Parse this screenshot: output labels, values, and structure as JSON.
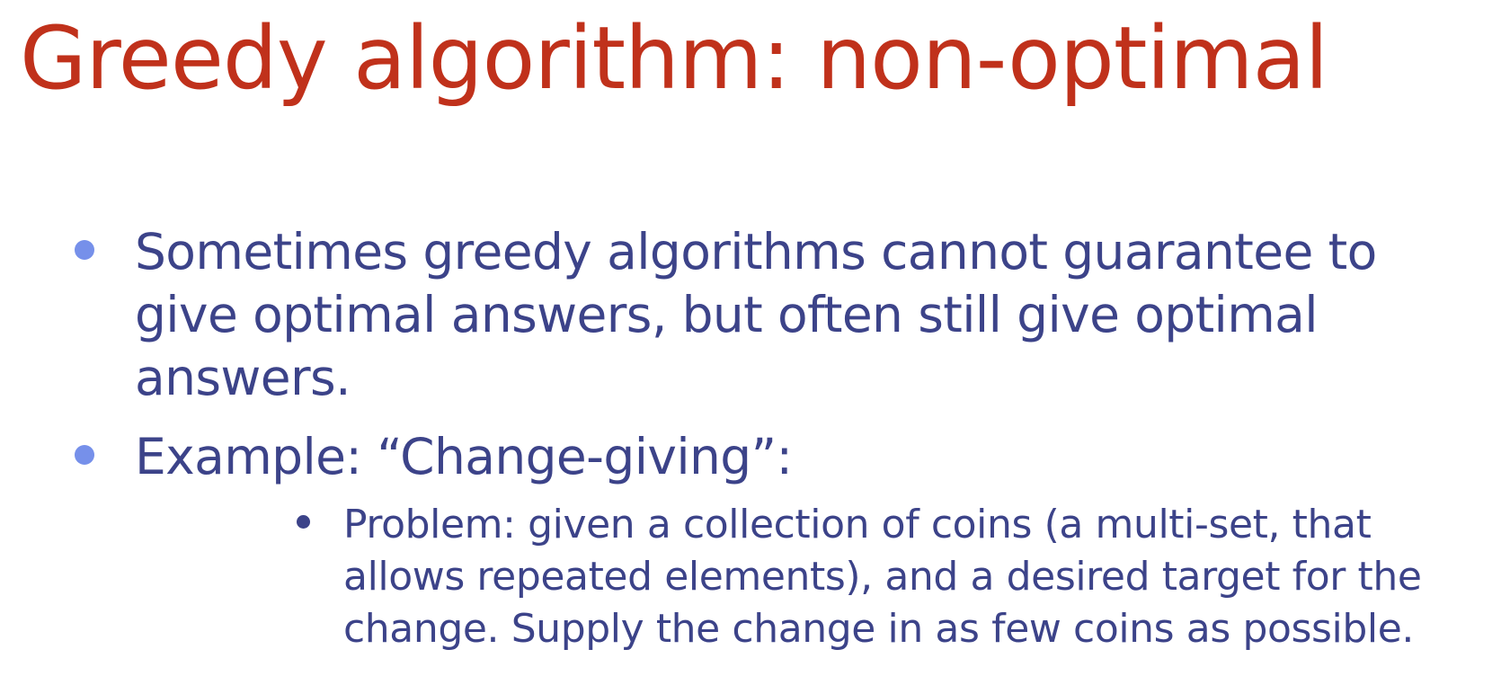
{
  "slide": {
    "title": "Greedy algorithm: non-optimal",
    "colors": {
      "title": "#c0311b",
      "body_text": "#3c4389",
      "bullet_level1": "#7690ea",
      "bullet_level2": "#3c4389",
      "background": "#ffffff"
    },
    "bullets": [
      {
        "text": "Sometimes greedy algorithms cannot guarantee to give optimal answers, but often still give optimal answers."
      },
      {
        "text": "Example:  “Change-giving”:",
        "sub_bullets": [
          {
            "text": "Problem: given a collection of coins (a multi-set, that allows repeated elements), and a desired target for the change. Supply the change in as few coins as possible."
          }
        ]
      }
    ]
  }
}
